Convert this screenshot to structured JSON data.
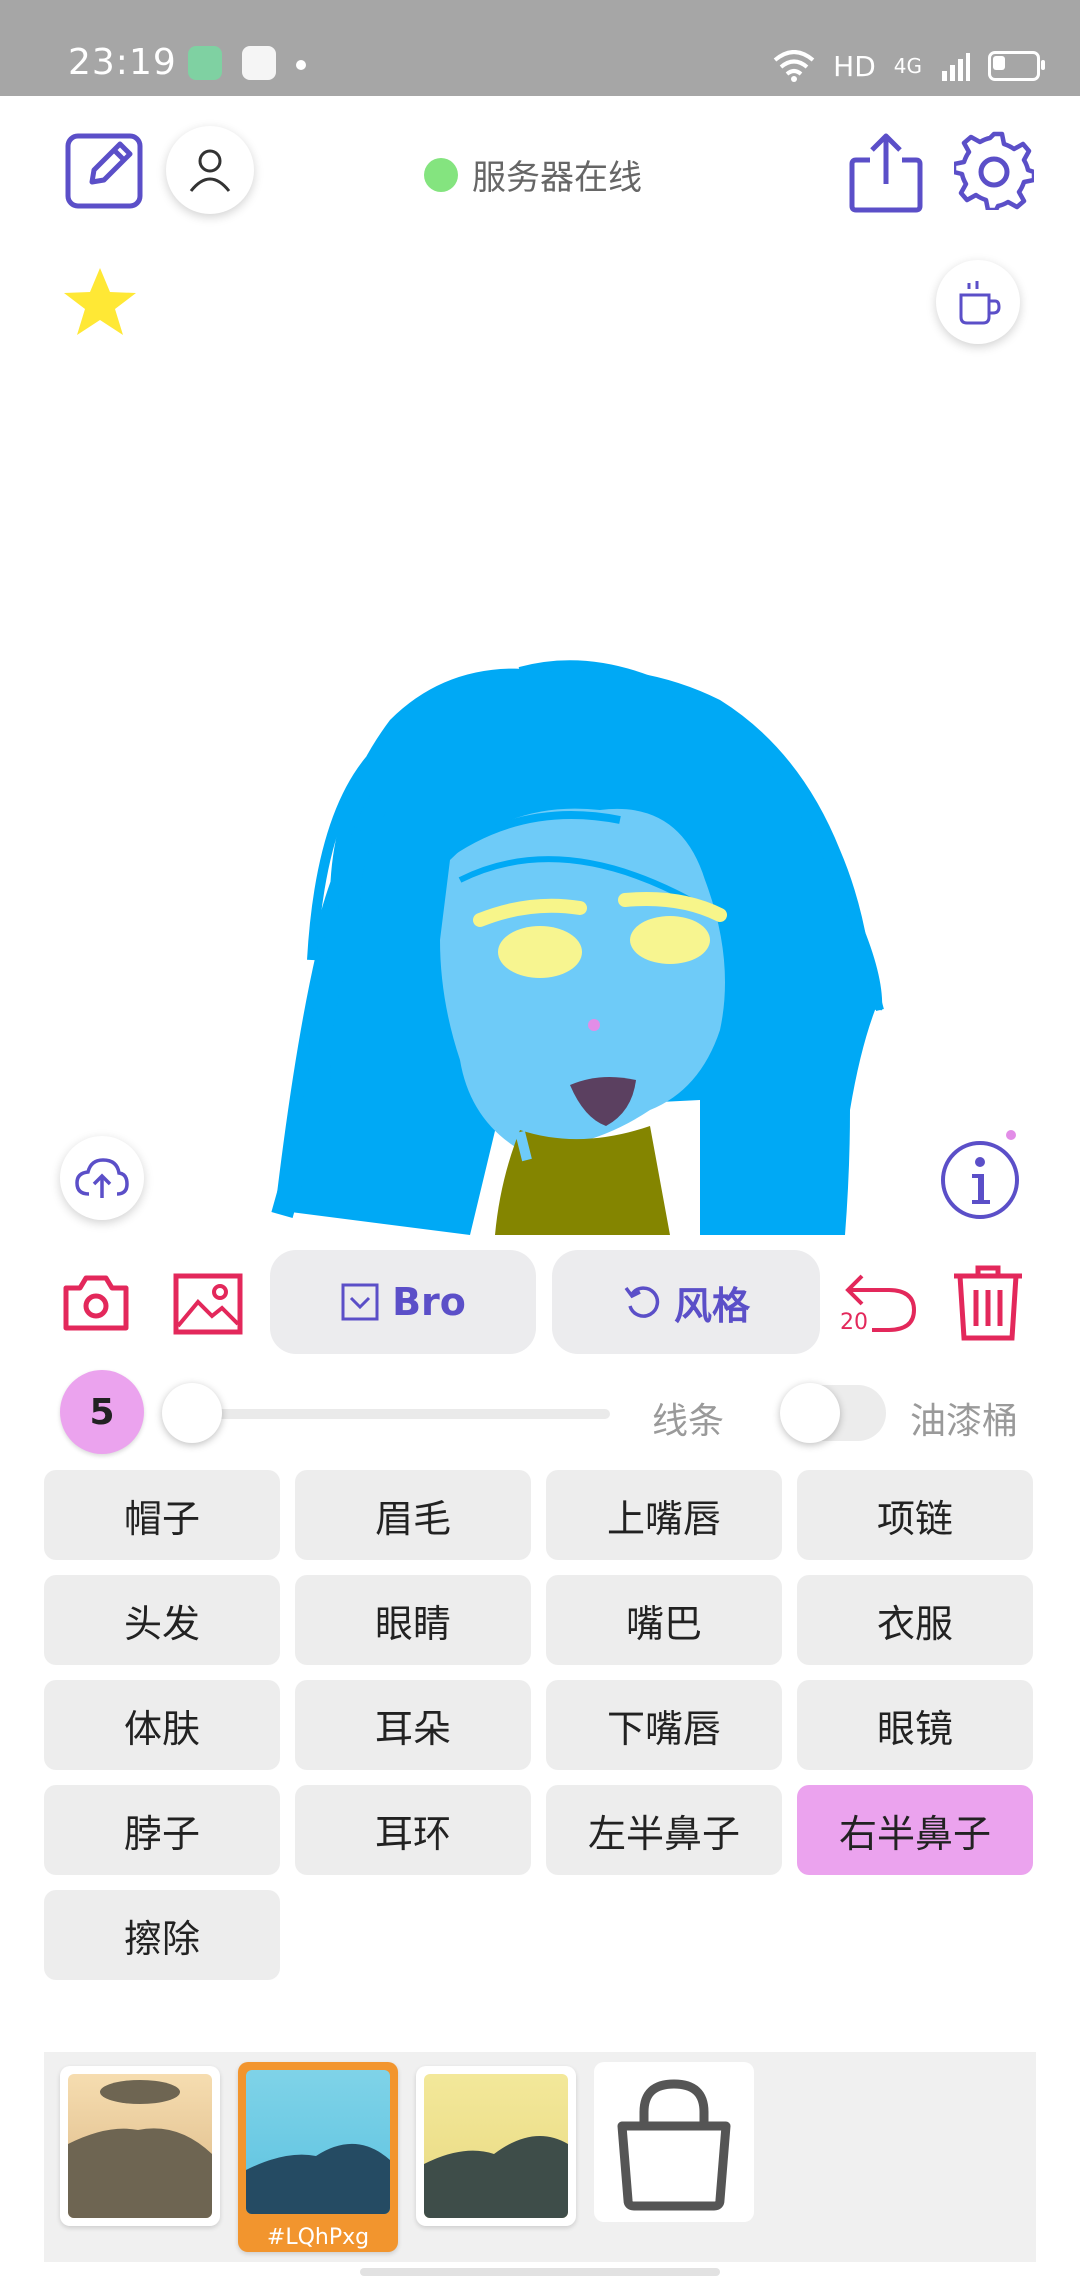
{
  "status_bar": {
    "time": "23:19",
    "network": "HD",
    "signal": "4G"
  },
  "header": {
    "server_status_text": "服务器在线",
    "server_status_color": "#84e47f",
    "accent_color": "#5b4fc8"
  },
  "toolbar": {
    "bro_label": "Bro",
    "style_label": "风格",
    "undo_count": "20",
    "icon_red": "#e3285b"
  },
  "brush": {
    "size": "5",
    "slider_value": 0.0,
    "line_label": "线条",
    "bucket_label": "油漆桶",
    "bucket_enabled": false
  },
  "parts": [
    {
      "label": "帽子",
      "selected": false
    },
    {
      "label": "眉毛",
      "selected": false
    },
    {
      "label": "上嘴唇",
      "selected": false
    },
    {
      "label": "项链",
      "selected": false
    },
    {
      "label": "头发",
      "selected": false
    },
    {
      "label": "眼睛",
      "selected": false
    },
    {
      "label": "嘴巴",
      "selected": false
    },
    {
      "label": "衣服",
      "selected": false
    },
    {
      "label": "体肤",
      "selected": false
    },
    {
      "label": "耳朵",
      "selected": false
    },
    {
      "label": "下嘴唇",
      "selected": false
    },
    {
      "label": "眼镜",
      "selected": false
    },
    {
      "label": "脖子",
      "selected": false
    },
    {
      "label": "耳环",
      "selected": false
    },
    {
      "label": "左半鼻子",
      "selected": false
    },
    {
      "label": "右半鼻子",
      "selected": true
    },
    {
      "label": "擦除",
      "selected": false
    }
  ],
  "palette": {
    "selected_swatch_label": "#LQhPxg"
  }
}
